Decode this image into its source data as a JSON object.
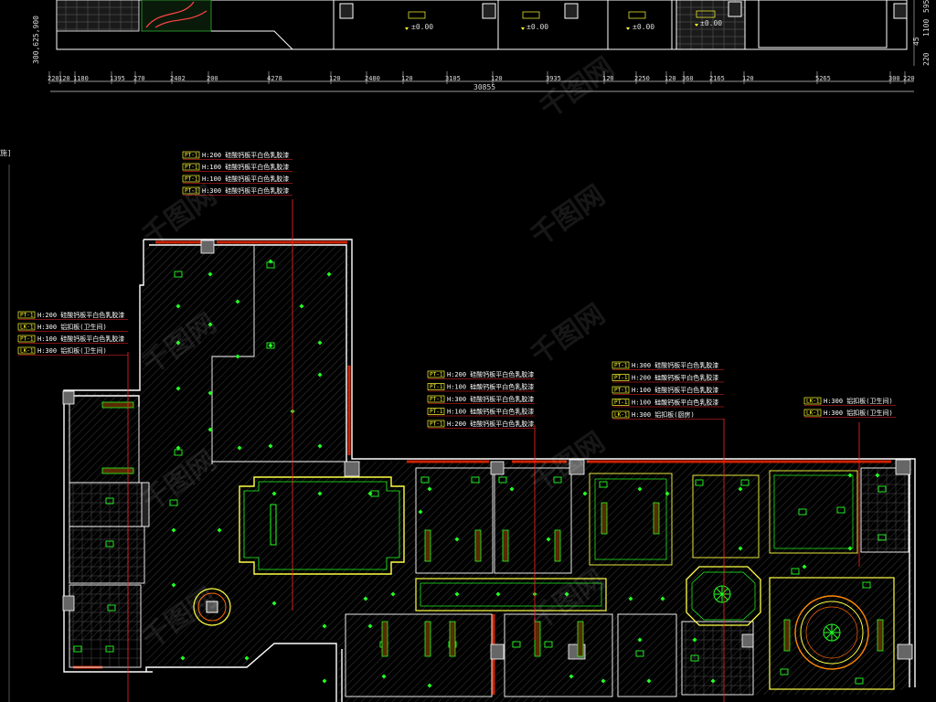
{
  "colors": {
    "background": "#000000",
    "wall": "#ffffff",
    "ceiling_outline": "#ffff44",
    "lamp": "#22ff22",
    "leader_line": "#ff2222",
    "dimension": "#d8d8d8",
    "tag_box": "#ffff33",
    "wall_red": "#cc2200"
  },
  "elevation": {
    "level_marks": [
      "±0.00",
      "±0.00",
      "±0.00",
      "±0.00"
    ],
    "left_vertical_dims": "300,625,900",
    "right_vertical_dims": [
      "45",
      "1100",
      "595",
      "220"
    ]
  },
  "dimension_chain": {
    "segments": [
      "220",
      "120",
      "1180",
      "1395",
      "270",
      "2402",
      "200",
      "4278",
      "120",
      "2480",
      "120",
      "3105",
      "120",
      "3935",
      "120",
      "2250",
      "120",
      "360",
      "2165",
      "120",
      "5265",
      "300",
      "220"
    ],
    "total": "30855"
  },
  "side_mark": "施]",
  "legend_groups": [
    {
      "id": "top",
      "items": [
        {
          "tag": "PT-1",
          "text": "H:200 硅酸钙板平白色乳胶漆"
        },
        {
          "tag": "PT-1",
          "text": "H:100 硅酸钙板平白色乳胶漆"
        },
        {
          "tag": "PT-1",
          "text": "H:100 硅酸钙板平白色乳胶漆"
        },
        {
          "tag": "PT-1",
          "text": "H:300 硅酸钙板平白色乳胶漆"
        }
      ]
    },
    {
      "id": "left",
      "items": [
        {
          "tag": "PT-1",
          "text": "H:200 硅酸钙板平白色乳胶漆"
        },
        {
          "tag": "LK-1",
          "text": "H:300 铝扣板(卫生间)"
        },
        {
          "tag": "PT-1",
          "text": "H:100 硅酸钙板平白色乳胶漆"
        },
        {
          "tag": "LK-1",
          "text": "H:300 铝扣板(卫生间)"
        }
      ]
    },
    {
      "id": "middle",
      "items": [
        {
          "tag": "PT-1",
          "text": "H:200 硅酸钙板平白色乳胶漆"
        },
        {
          "tag": "PT-1",
          "text": "H:100 硅酸钙板平白色乳胶漆"
        },
        {
          "tag": "PT-1",
          "text": "H:300 硅酸钙板平白色乳胶漆"
        },
        {
          "tag": "PT-1",
          "text": "H:100 硅酸钙板平白色乳胶漆"
        },
        {
          "tag": "PT-1",
          "text": "H:200 硅酸钙板平白色乳胶漆"
        }
      ]
    },
    {
      "id": "center-right",
      "items": [
        {
          "tag": "PT-1",
          "text": "H:300 硅酸钙板平白色乳胶漆"
        },
        {
          "tag": "PT-1",
          "text": "H:200 硅酸钙板平白色乳胶漆"
        },
        {
          "tag": "PT-1",
          "text": "H:100 硅酸钙板平白色乳胶漆"
        },
        {
          "tag": "PT-1",
          "text": "H:100 硅酸钙板平白色乳胶漆"
        },
        {
          "tag": "LK-1",
          "text": "H:300 铝扣板(厨房)"
        }
      ]
    },
    {
      "id": "right",
      "items": [
        {
          "tag": "LK-1",
          "text": "H:300 铝扣板(卫生间)"
        },
        {
          "tag": "LK-1",
          "text": "H:300 铝扣板(卫生间)"
        }
      ]
    }
  ],
  "watermark": "千图网"
}
